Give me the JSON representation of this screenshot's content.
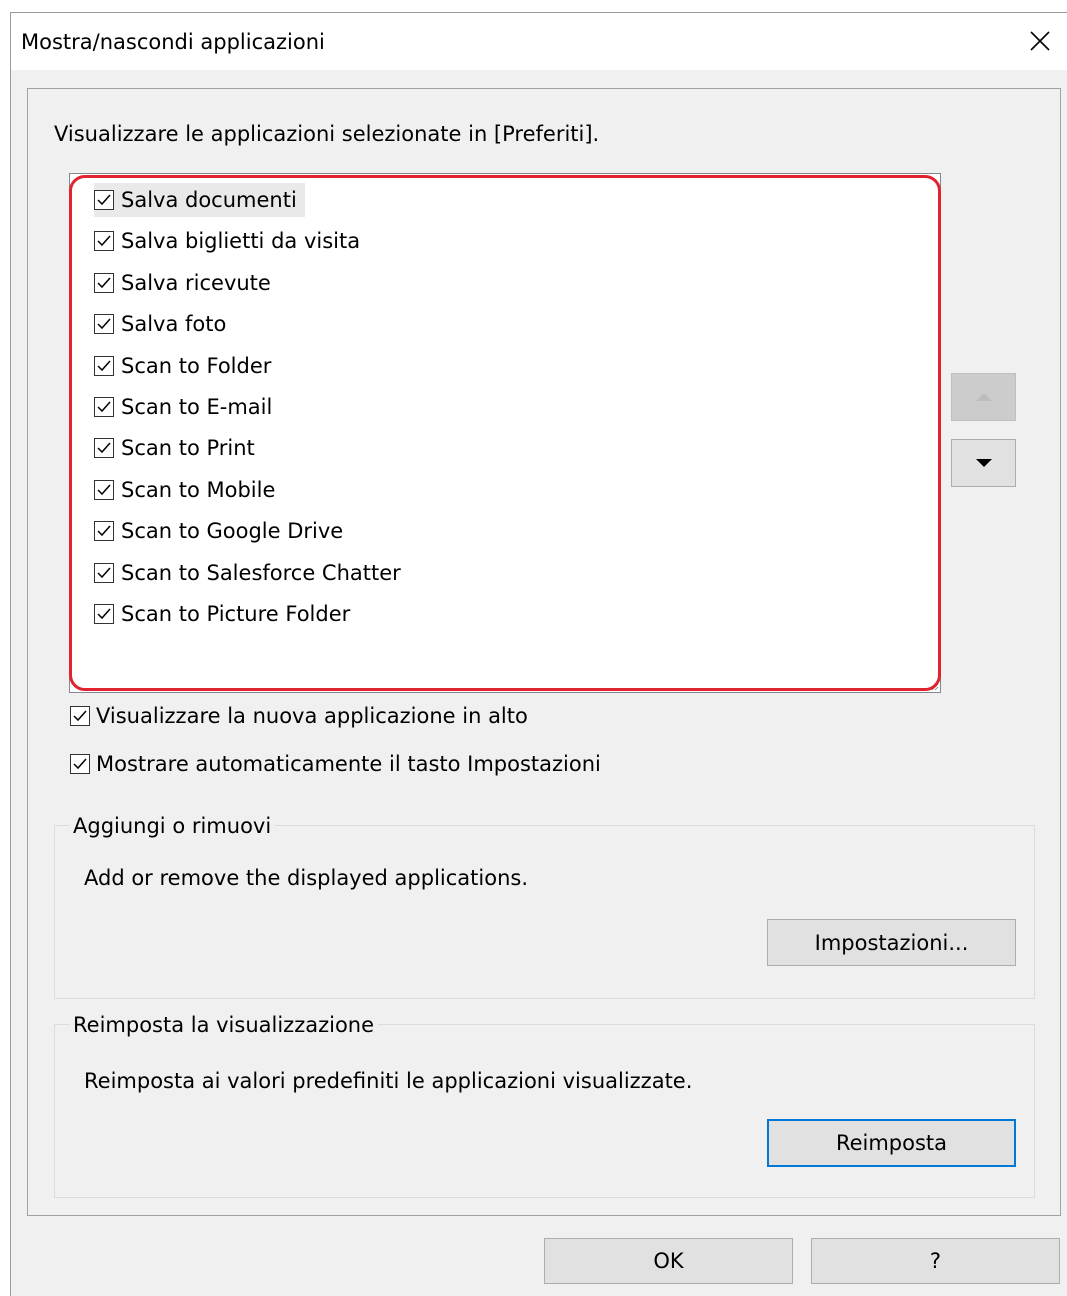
{
  "window": {
    "title": "Mostra/nascondi applicazioni",
    "close_icon": "close-icon"
  },
  "instructions": "Visualizzare le applicazioni selezionate in [Preferiti].",
  "app_list": {
    "items": [
      {
        "label": "Salva documenti",
        "checked": true,
        "selected": true
      },
      {
        "label": "Salva biglietti da visita",
        "checked": true
      },
      {
        "label": "Salva ricevute",
        "checked": true
      },
      {
        "label": "Salva foto",
        "checked": true
      },
      {
        "label": "Scan to Folder",
        "checked": true
      },
      {
        "label": "Scan to E-mail",
        "checked": true
      },
      {
        "label": "Scan to Print",
        "checked": true
      },
      {
        "label": "Scan to Mobile",
        "checked": true
      },
      {
        "label": "Scan to Google Drive",
        "checked": true
      },
      {
        "label": "Scan to Salesforce Chatter",
        "checked": true
      },
      {
        "label": "Scan to Picture Folder",
        "checked": true
      }
    ],
    "highlight_color": "#e0232e"
  },
  "move_buttons": {
    "up_icon": "triangle-up-icon",
    "up_enabled": false,
    "down_icon": "triangle-down-icon",
    "down_enabled": true
  },
  "options": {
    "new_app_on_top": {
      "label": "Visualizzare la nuova applicazione in alto",
      "checked": true
    },
    "auto_show_settings": {
      "label": "Mostrare automaticamente il tasto Impostazioni",
      "checked": true
    }
  },
  "add_remove_group": {
    "title": "Aggiungi o rimuovi",
    "description": "Add or remove the displayed applications.",
    "button_label": "Impostazioni..."
  },
  "reset_group": {
    "title": "Reimposta la visualizzazione",
    "description": "Reimposta ai valori predefiniti le applicazioni visualizzate.",
    "button_label": "Reimposta"
  },
  "footer": {
    "ok_label": "OK",
    "help_label": "?"
  },
  "colors": {
    "dialog_bg": "#f0f0f0",
    "button_bg": "#e1e1e1",
    "default_button_border": "#0078d7"
  }
}
